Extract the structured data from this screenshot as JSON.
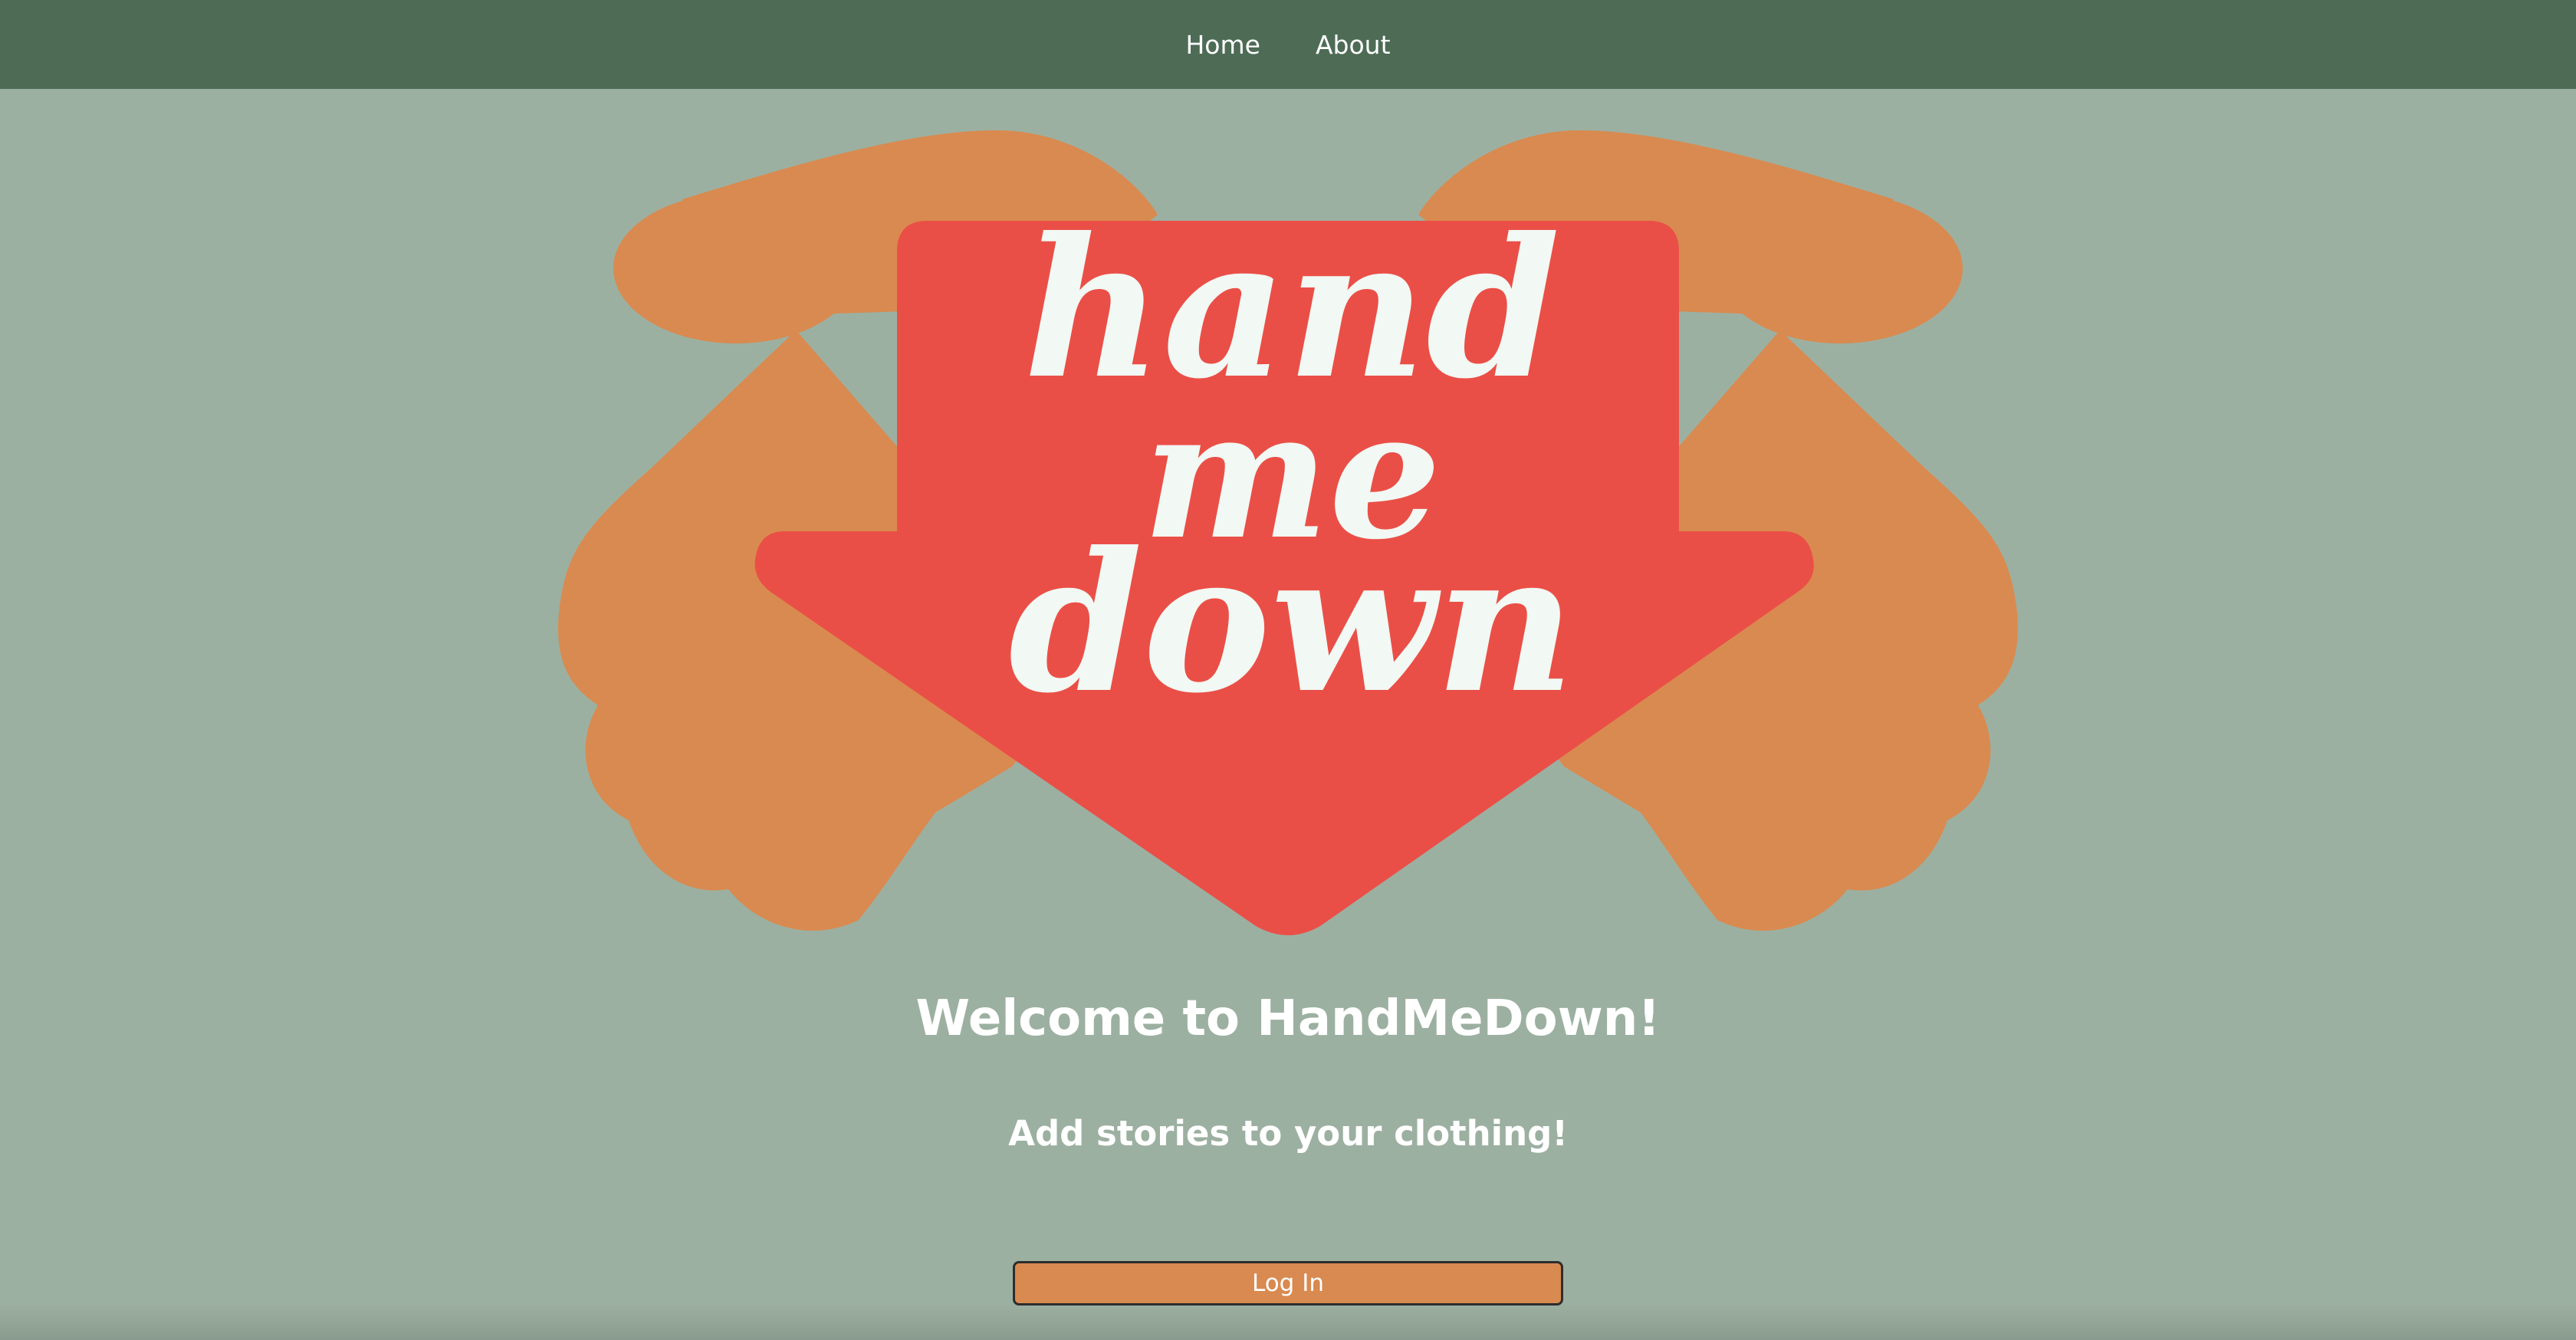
{
  "nav": {
    "home_label": "Home",
    "about_label": "About"
  },
  "logo": {
    "line1": "hand",
    "line2": "me",
    "line3": "down",
    "hand_color": "#d98a50",
    "arrow_color": "#ea4f47",
    "text_color": "#f2f8f3"
  },
  "hero": {
    "title": "Welcome to HandMeDown!",
    "subtitle": "Add stories to your clothing!"
  },
  "login": {
    "label": "Log In"
  },
  "colors": {
    "nav_bg": "#4d6b55",
    "page_bg": "#9cb0a1",
    "button_bg": "#d98a50"
  }
}
